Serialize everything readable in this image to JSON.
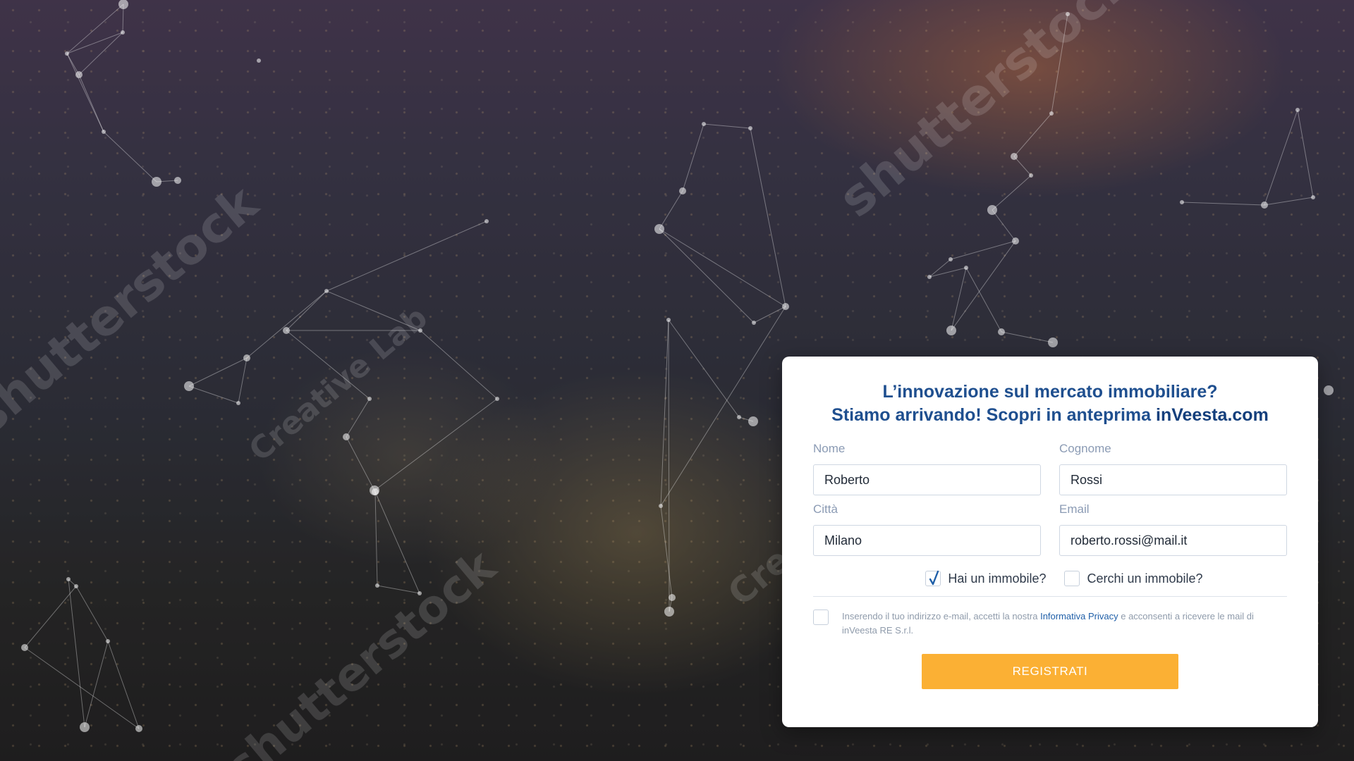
{
  "background": {
    "description_colors": {
      "sky_glow": "#d67a40",
      "plaza_glow": "#bea05a",
      "base": "#2b2a3a"
    }
  },
  "watermarks": {
    "stock": "shutterstock",
    "lab": "Creative Lab"
  },
  "form": {
    "headline_line1": "L’innovazione sul mercato immobiliare?",
    "headline_line2_prefix": "Stiamo arrivando! Scopri in anteprima ",
    "headline_brand": "inVeesta.com",
    "fields": {
      "nome": {
        "label": "Nome",
        "value": "Roberto"
      },
      "cognome": {
        "label": "Cognome",
        "value": "Rossi"
      },
      "citta": {
        "label": "Città",
        "value": "Milano"
      },
      "email": {
        "label": "Email",
        "value": "roberto.rossi@mail.it"
      }
    },
    "options": {
      "has_property": {
        "label": "Hai un immobile?",
        "checked": true
      },
      "seeks_property": {
        "label": "Cerchi un immobile?",
        "checked": false
      }
    },
    "consent": {
      "text_before": "Inserendo il tuo indirizzo e-mail, accetti la nostra ",
      "link": "Informativa Privacy",
      "text_after": " e acconsenti a ricevere le mail di inVeesta RE S.r.l.",
      "checked": false
    },
    "submit_label": "REGISTRATI",
    "colors": {
      "heading": "#1f4f8f",
      "button": "#fbb034",
      "link": "#1f5fa8",
      "checkmark": "#1f5fa8"
    }
  }
}
